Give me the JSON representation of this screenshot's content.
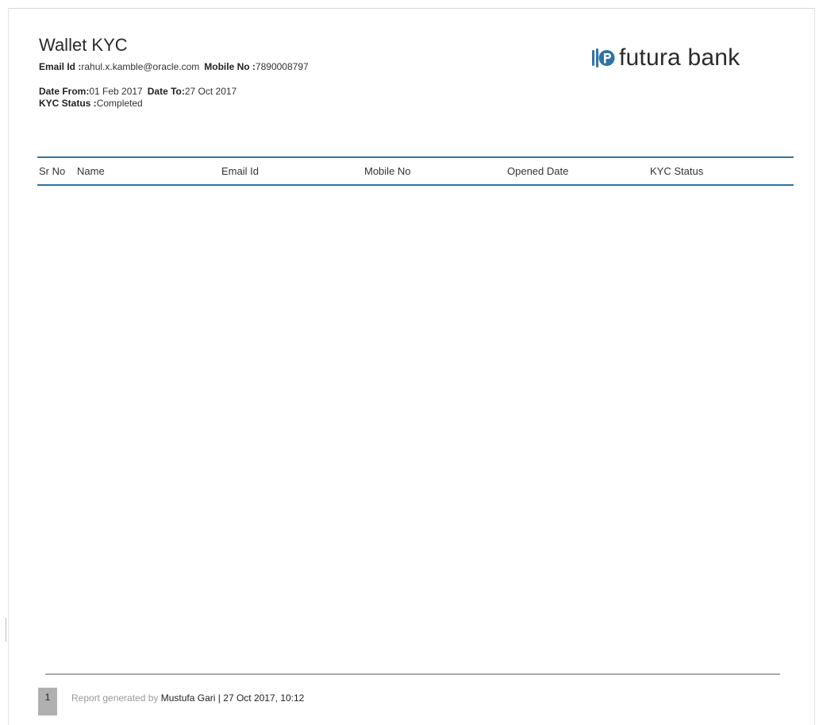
{
  "report": {
    "title": "Wallet KYC",
    "email_label": "Email Id :",
    "email_value": "rahul.x.kamble@oracle.com",
    "mobile_label": "Mobile No :",
    "mobile_value": "7890008797",
    "date_from_label": "Date From:",
    "date_from_value": "01 Feb 2017",
    "date_to_label": "Date To:",
    "date_to_value": "27 Oct 2017",
    "kyc_status_label": "KYC Status :",
    "kyc_status_value": "Completed"
  },
  "brand": {
    "name": "futura bank",
    "icon": "futura-bank-logo-icon",
    "accent": "#2f74a6"
  },
  "table": {
    "columns": [
      "Sr No",
      "Name",
      "Email Id",
      "Mobile No",
      "Opened Date",
      "KYC Status"
    ],
    "rows": []
  },
  "footer": {
    "page_number": "1",
    "generated_prefix": "Report generated by",
    "generated_user": "Mustufa Gari",
    "separator": "|",
    "generated_datetime": "27 Oct 2017, 10:12"
  }
}
